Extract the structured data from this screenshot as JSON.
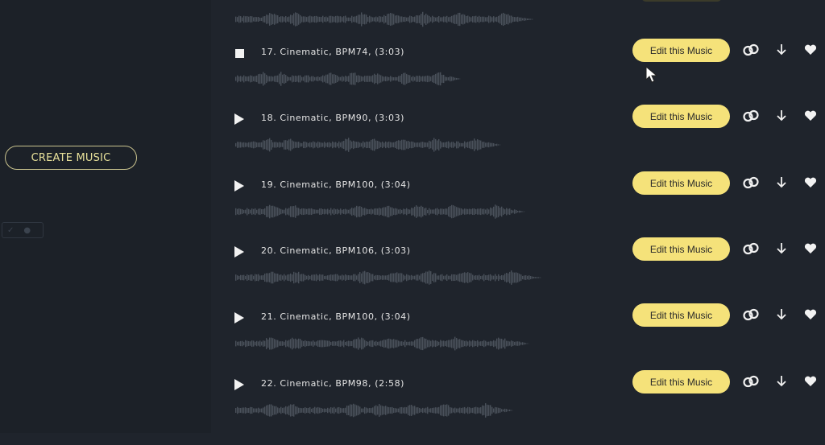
{
  "sidebar": {
    "create_music_label": "CREATE MUSIC"
  },
  "tracks": [
    {
      "title": "17. Cinematic, BPM74, (3:03)",
      "state": "playing",
      "edit_label": "Edit this Music"
    },
    {
      "title": "18. Cinematic, BPM90, (3:03)",
      "state": "paused",
      "edit_label": "Edit this Music"
    },
    {
      "title": "19. Cinematic, BPM100, (3:04)",
      "state": "paused",
      "edit_label": "Edit this Music"
    },
    {
      "title": "20. Cinematic, BPM106, (3:03)",
      "state": "paused",
      "edit_label": "Edit this Music"
    },
    {
      "title": "21. Cinematic, BPM100, (3:04)",
      "state": "paused",
      "edit_label": "Edit this Music"
    },
    {
      "title": "22. Cinematic, BPM98, (2:58)",
      "state": "paused",
      "edit_label": "Edit this Music"
    }
  ],
  "icons": {
    "link": "link-icon",
    "download": "download-icon",
    "favorite": "heart-icon",
    "play": "play-icon",
    "stop": "stop-icon"
  },
  "colors": {
    "background": "#1f242c",
    "accent": "#f5e27a",
    "create_outline": "#c9c38e",
    "waveform": "#4a515b"
  }
}
